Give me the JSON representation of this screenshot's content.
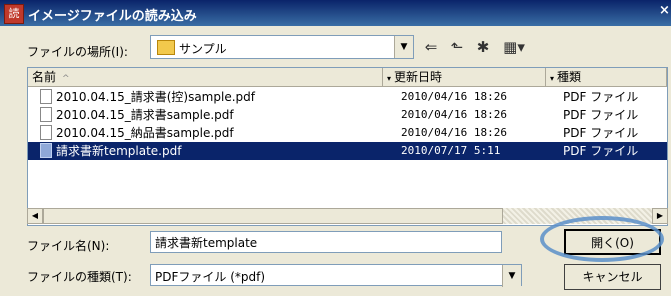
{
  "window": {
    "title": "イメージファイルの読み込み",
    "icon_glyph": "読",
    "close_glyph": "×"
  },
  "location": {
    "label": "ファイルの場所(I):",
    "value": "サンプル",
    "tools": [
      "⇐",
      "⬑",
      "✱",
      "▦▾"
    ]
  },
  "file_list": {
    "columns": [
      {
        "label": "名前",
        "sort_glyph": "^"
      },
      {
        "label": "更新日時"
      },
      {
        "label": "種類"
      }
    ],
    "rows": [
      {
        "name": "2010.04.15_請求書(控)sample.pdf",
        "modified": "2010/04/16 18:26",
        "type": "PDF ファイル",
        "selected": false
      },
      {
        "name": "2010.04.15_請求書sample.pdf",
        "modified": "2010/04/16 18:26",
        "type": "PDF ファイル",
        "selected": false
      },
      {
        "name": "2010.04.15_納品書sample.pdf",
        "modified": "2010/04/16 18:26",
        "type": "PDF ファイル",
        "selected": false
      },
      {
        "name": "請求書新template.pdf",
        "modified": "2010/07/17 5:11",
        "type": "PDF ファイル",
        "selected": true
      }
    ]
  },
  "filename": {
    "label": "ファイル名(N):",
    "value": "請求書新template"
  },
  "filetype": {
    "label": "ファイルの種類(T):",
    "value": "PDFファイル (*pdf)"
  },
  "buttons": {
    "open": "開く(O)",
    "cancel": "キャンセル"
  },
  "colors": {
    "selection": "#0a246a",
    "highlight_ring": "#5b8fc9"
  }
}
